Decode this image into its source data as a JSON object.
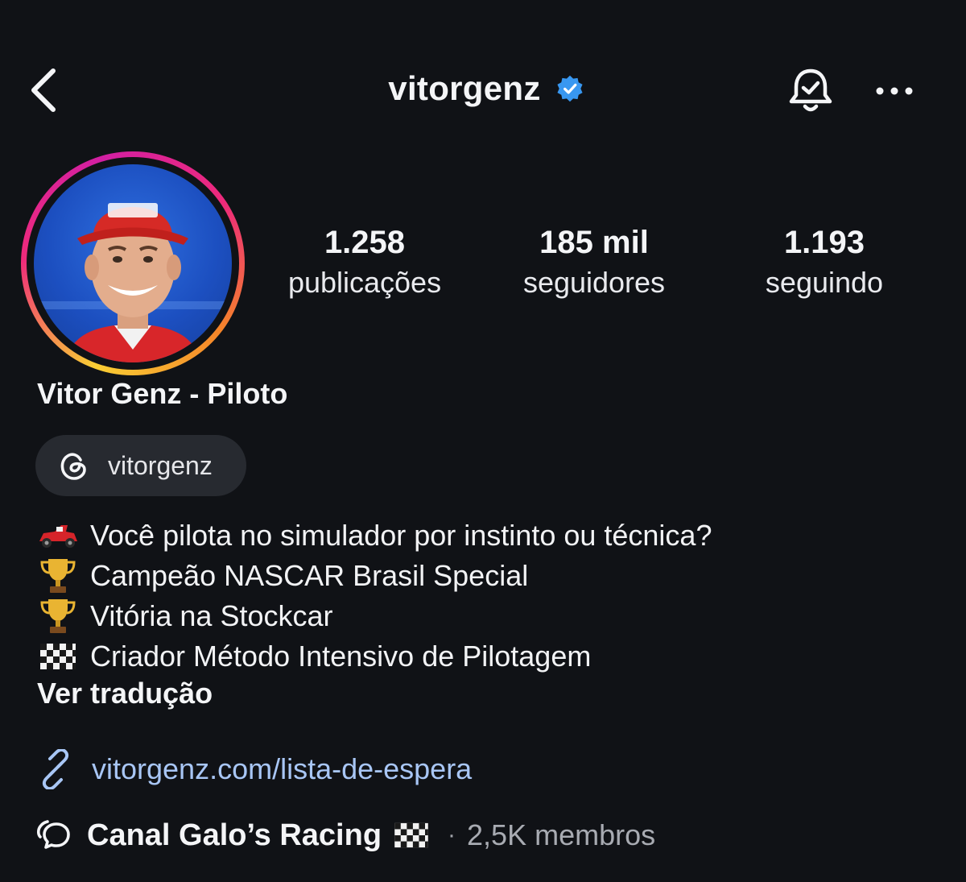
{
  "header": {
    "username": "vitorgenz",
    "verified": true,
    "icons": {
      "back": "chevron-left-icon",
      "bell": "notification-bell-icon",
      "more": "more-horizontal-icon"
    }
  },
  "profile": {
    "avatar": "profile-avatar",
    "stats": [
      {
        "value": "1.258",
        "label": "publicações"
      },
      {
        "value": "185 mil",
        "label": "seguidores"
      },
      {
        "value": "1.193",
        "label": "seguindo"
      }
    ],
    "display_name": "Vitor Genz - Piloto",
    "threads_handle": "vitorgenz"
  },
  "bio": {
    "lines": [
      {
        "emoji": "race-car-icon",
        "text": "Você pilota no simulador por instinto ou técnica?"
      },
      {
        "emoji": "trophy-icon",
        "text": "Campeão NASCAR Brasil Special"
      },
      {
        "emoji": "trophy-icon",
        "text": "Vitória na Stockcar"
      },
      {
        "emoji": "checkered-flag-icon",
        "text": "Criador Método Intensivo de Pilotagem"
      }
    ],
    "translate_label": "Ver tradução"
  },
  "link": {
    "text": "vitorgenz.com/lista-de-espera"
  },
  "channel": {
    "name": "Canal Galo’s Racing",
    "separator": "·",
    "members": "2,5K membros"
  },
  "colors": {
    "background": "#101216",
    "verified_blue": "#3897f0",
    "link": "#a8c6f5",
    "chip": "#272a30"
  }
}
